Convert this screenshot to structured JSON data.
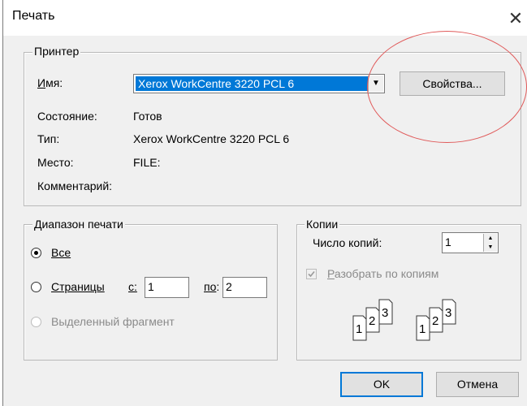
{
  "window": {
    "title": "Печать",
    "close_glyph": "✕"
  },
  "printer_group": {
    "legend": "Принтер",
    "name_label": "Имя:",
    "name_underline": "И",
    "name_rest": "мя:",
    "selected_printer": "Xerox WorkCentre 3220 PCL 6",
    "properties_button": "Свойства...",
    "status_label": "Состояние:",
    "status_value": "Готов",
    "type_label": "Тип:",
    "type_value": "Xerox WorkCentre 3220 PCL 6",
    "where_label": "Место:",
    "where_value": "FILE:",
    "comment_label": "Комментарий:"
  },
  "range_group": {
    "legend": "Диапазон печати",
    "all_label": "Все",
    "pages_label": "Страницы",
    "from_label": "с:",
    "from_value": "1",
    "to_label": "по:",
    "to_value": "2",
    "selection_label": "Выделенный фрагмент",
    "selected": "all"
  },
  "copies_group": {
    "legend": "Копии",
    "count_label": "Число копий:",
    "count_value": "1",
    "collate_label": "Разобрать по копиям",
    "collate_checked": true,
    "collate_enabled": false,
    "collate_icon_labels": [
      "1",
      "2",
      "3"
    ]
  },
  "buttons": {
    "ok": "OK",
    "cancel": "Отмена"
  },
  "colors": {
    "selection": "#0078d7",
    "annotation": "#e05a5a",
    "dialog_bg": "#f0f0f0"
  }
}
